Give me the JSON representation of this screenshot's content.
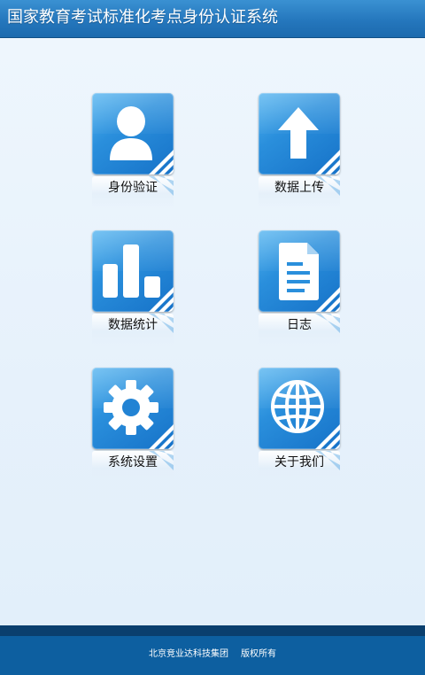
{
  "app": {
    "title": "国家教育考试标准化考点身份认证系统"
  },
  "menu": {
    "items": [
      {
        "label": "身份验证",
        "icon": "user-icon"
      },
      {
        "label": "数据上传",
        "icon": "upload-arrow-icon"
      },
      {
        "label": "数据统计",
        "icon": "bar-chart-icon"
      },
      {
        "label": "日志",
        "icon": "document-icon"
      },
      {
        "label": "系统设置",
        "icon": "gear-icon"
      },
      {
        "label": "关于我们",
        "icon": "globe-icon"
      }
    ]
  },
  "footer": {
    "company": "北京竞业达科技集团",
    "rights": "版权所有"
  },
  "colors": {
    "title_bar": "#2577bd",
    "tile_blue": "#1672c8",
    "footer": "#0d5fa0",
    "background": "#e8f3fc"
  }
}
